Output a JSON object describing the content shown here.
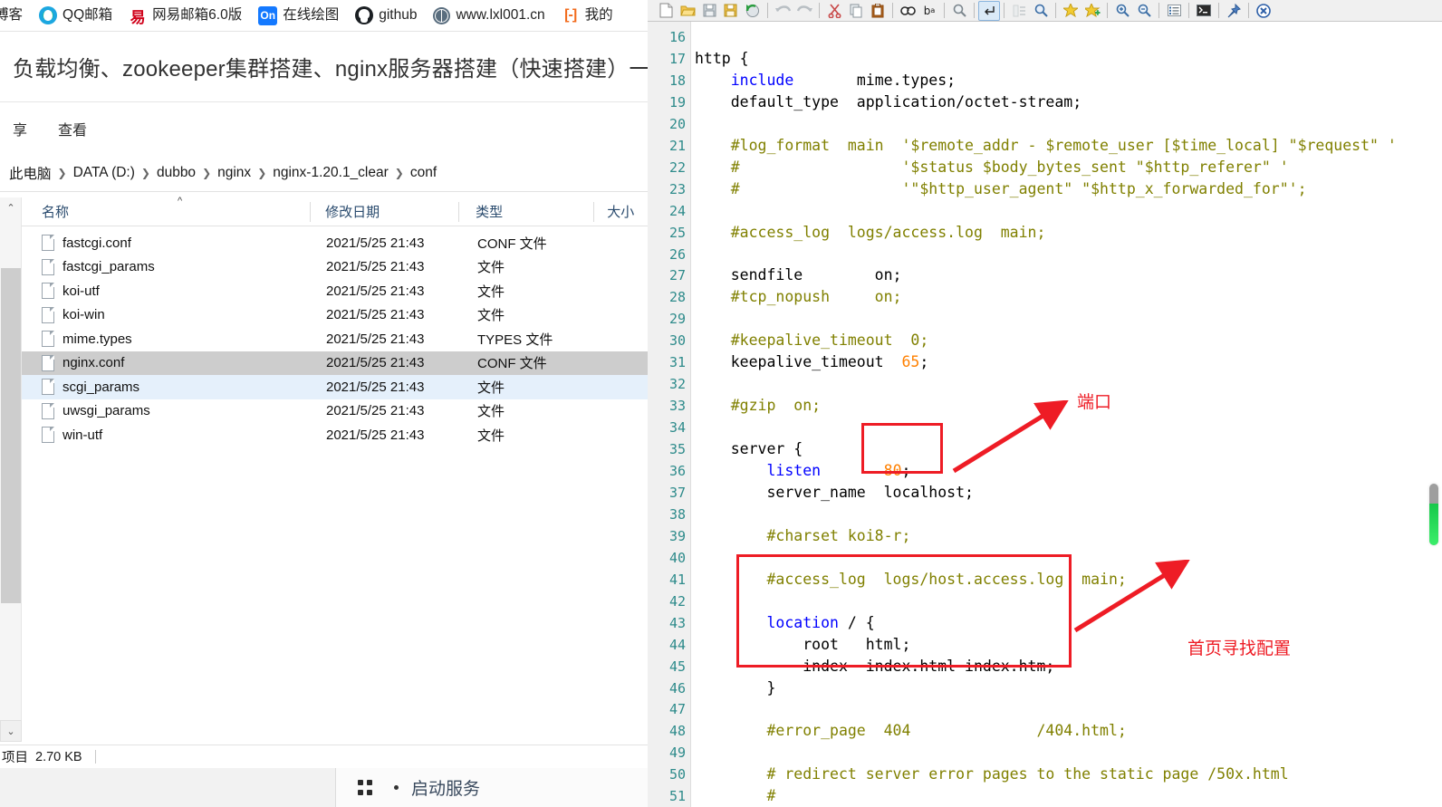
{
  "browser": {
    "bookmarks": [
      {
        "label": "博客",
        "icon": "blog-icon"
      },
      {
        "label": "QQ邮箱",
        "icon": "qq-mail-icon"
      },
      {
        "label": "网易邮箱6.0版",
        "icon": "netease-mail-icon"
      },
      {
        "label": "在线绘图",
        "icon": "online-draw-icon"
      },
      {
        "label": "github",
        "icon": "github-icon"
      },
      {
        "label": "www.lxl001.cn",
        "icon": "globe-icon"
      },
      {
        "label": "我的",
        "icon": "bracket-icon"
      }
    ],
    "page_title": "负载均衡、zookeeper集群搭建、nginx服务器搭建（快速搭建）一文就够"
  },
  "explorer": {
    "ribbon_tabs": [
      {
        "label": "享"
      },
      {
        "label": "查看"
      }
    ],
    "breadcrumb": [
      "此电脑",
      "DATA (D:)",
      "dubbo",
      "nginx",
      "nginx-1.20.1_clear",
      "conf"
    ],
    "columns": {
      "name": "名称",
      "date": "修改日期",
      "type": "类型",
      "size": "大小"
    },
    "sort_caret": "^",
    "files": [
      {
        "name": "fastcgi.conf",
        "date": "2021/5/25 21:43",
        "type": "CONF 文件",
        "state": "normal"
      },
      {
        "name": "fastcgi_params",
        "date": "2021/5/25 21:43",
        "type": "文件",
        "state": "normal"
      },
      {
        "name": "koi-utf",
        "date": "2021/5/25 21:43",
        "type": "文件",
        "state": "normal"
      },
      {
        "name": "koi-win",
        "date": "2021/5/25 21:43",
        "type": "文件",
        "state": "normal"
      },
      {
        "name": "mime.types",
        "date": "2021/5/25 21:43",
        "type": "TYPES 文件",
        "state": "normal"
      },
      {
        "name": "nginx.conf",
        "date": "2021/5/25 21:43",
        "type": "CONF 文件",
        "state": "selected-strong"
      },
      {
        "name": "scgi_params",
        "date": "2021/5/25 21:43",
        "type": "文件",
        "state": "selected-light"
      },
      {
        "name": "uwsgi_params",
        "date": "2021/5/25 21:43",
        "type": "文件",
        "state": "normal"
      },
      {
        "name": "win-utf",
        "date": "2021/5/25 21:43",
        "type": "文件",
        "state": "normal"
      }
    ],
    "status_items_label": "项目",
    "status_size": "2.70 KB"
  },
  "taskbar": {
    "sort_icon": "sort-handles-icon",
    "item_label": "启动服务"
  },
  "notepad": {
    "toolbar_buttons": [
      {
        "name": "new-file-icon",
        "glyph": "🗋"
      },
      {
        "name": "open-folder-icon",
        "glyph": "📂"
      },
      {
        "name": "save-icon",
        "glyph": "💾"
      },
      {
        "name": "save-all-icon",
        "glyph": "🖫"
      },
      {
        "name": "reload-icon",
        "glyph": "⟳"
      },
      {
        "name": "separator",
        "glyph": "|"
      },
      {
        "name": "undo-icon",
        "glyph": "↩"
      },
      {
        "name": "redo-icon",
        "glyph": "↪"
      },
      {
        "name": "separator",
        "glyph": "|"
      },
      {
        "name": "cut-icon",
        "glyph": "✂"
      },
      {
        "name": "copy-icon",
        "glyph": "⧉"
      },
      {
        "name": "paste-icon",
        "glyph": "📋"
      },
      {
        "name": "separator",
        "glyph": "|"
      },
      {
        "name": "find-icon",
        "glyph": "🔍"
      },
      {
        "name": "replace-icon",
        "glyph": "ᵇₐ"
      },
      {
        "name": "separator",
        "glyph": "|"
      },
      {
        "name": "find-prev-icon",
        "glyph": "🔎"
      },
      {
        "name": "separator",
        "glyph": "|"
      },
      {
        "name": "show-all-chars-icon",
        "glyph": "⏎"
      },
      {
        "name": "separator",
        "glyph": "|"
      },
      {
        "name": "indent-guide-icon",
        "glyph": "▤"
      },
      {
        "name": "zoom-sel-icon",
        "glyph": "🔍"
      },
      {
        "name": "separator",
        "glyph": "|"
      },
      {
        "name": "bookmark-icon",
        "glyph": "★"
      },
      {
        "name": "bookmark-add-icon",
        "glyph": "★"
      },
      {
        "name": "separator",
        "glyph": "|"
      },
      {
        "name": "zoom-in-icon",
        "glyph": "🔍"
      },
      {
        "name": "zoom-out-icon",
        "glyph": "🔍"
      },
      {
        "name": "separator",
        "glyph": "|"
      },
      {
        "name": "doc-list-icon",
        "glyph": "▤"
      },
      {
        "name": "separator",
        "glyph": "|"
      },
      {
        "name": "run-console-icon",
        "glyph": "▣"
      },
      {
        "name": "separator",
        "glyph": "|"
      },
      {
        "name": "pin-icon",
        "glyph": "📌"
      },
      {
        "name": "separator",
        "glyph": "|"
      },
      {
        "name": "close-icon",
        "glyph": "✖"
      }
    ],
    "first_line_number": 16,
    "code_lines": [
      {
        "n": 16,
        "tokens": []
      },
      {
        "n": 17,
        "tokens": [
          {
            "t": "http {",
            "c": "plain"
          }
        ]
      },
      {
        "n": 18,
        "tokens": [
          {
            "t": "    ",
            "c": "plain"
          },
          {
            "t": "include",
            "c": "kw"
          },
          {
            "t": "       mime.types;",
            "c": "plain"
          }
        ]
      },
      {
        "n": 19,
        "tokens": [
          {
            "t": "    default_type  application/octet-stream;",
            "c": "plain"
          }
        ]
      },
      {
        "n": 20,
        "tokens": []
      },
      {
        "n": 21,
        "tokens": [
          {
            "t": "    #log_format  main  '$remote_addr - $remote_user [$time_local] \"$request\" '",
            "c": "com"
          }
        ]
      },
      {
        "n": 22,
        "tokens": [
          {
            "t": "    #                  '$status $body_bytes_sent \"$http_referer\" '",
            "c": "com"
          }
        ]
      },
      {
        "n": 23,
        "tokens": [
          {
            "t": "    #                  '\"$http_user_agent\" \"$http_x_forwarded_for\"';",
            "c": "com"
          }
        ]
      },
      {
        "n": 24,
        "tokens": []
      },
      {
        "n": 25,
        "tokens": [
          {
            "t": "    #access_log  logs/access.log  main;",
            "c": "com"
          }
        ]
      },
      {
        "n": 26,
        "tokens": []
      },
      {
        "n": 27,
        "tokens": [
          {
            "t": "    sendfile        on;",
            "c": "plain"
          }
        ]
      },
      {
        "n": 28,
        "tokens": [
          {
            "t": "    #tcp_nopush     on;",
            "c": "com"
          }
        ]
      },
      {
        "n": 29,
        "tokens": []
      },
      {
        "n": 30,
        "tokens": [
          {
            "t": "    #keepalive_timeout  0;",
            "c": "com"
          }
        ]
      },
      {
        "n": 31,
        "tokens": [
          {
            "t": "    keepalive_timeout  ",
            "c": "plain"
          },
          {
            "t": "65",
            "c": "num"
          },
          {
            "t": ";",
            "c": "plain"
          }
        ]
      },
      {
        "n": 32,
        "tokens": []
      },
      {
        "n": 33,
        "tokens": [
          {
            "t": "    #gzip  on;",
            "c": "com"
          }
        ]
      },
      {
        "n": 34,
        "tokens": []
      },
      {
        "n": 35,
        "tokens": [
          {
            "t": "    server {",
            "c": "plain"
          }
        ]
      },
      {
        "n": 36,
        "tokens": [
          {
            "t": "        ",
            "c": "plain"
          },
          {
            "t": "listen",
            "c": "kw"
          },
          {
            "t": "       ",
            "c": "plain"
          },
          {
            "t": "80",
            "c": "num"
          },
          {
            "t": ";",
            "c": "plain"
          }
        ]
      },
      {
        "n": 37,
        "tokens": [
          {
            "t": "        server_name  localhost;",
            "c": "plain"
          }
        ]
      },
      {
        "n": 38,
        "tokens": []
      },
      {
        "n": 39,
        "tokens": [
          {
            "t": "        #charset koi8-r;",
            "c": "com"
          }
        ]
      },
      {
        "n": 40,
        "tokens": []
      },
      {
        "n": 41,
        "tokens": [
          {
            "t": "        #access_log  logs/host.access.log  main;",
            "c": "com"
          }
        ]
      },
      {
        "n": 42,
        "tokens": []
      },
      {
        "n": 43,
        "tokens": [
          {
            "t": "        ",
            "c": "plain"
          },
          {
            "t": "location",
            "c": "kw"
          },
          {
            "t": " / {",
            "c": "plain"
          }
        ]
      },
      {
        "n": 44,
        "tokens": [
          {
            "t": "            root   html;",
            "c": "plain"
          }
        ]
      },
      {
        "n": 45,
        "tokens": [
          {
            "t": "            index  index.html index.htm;",
            "c": "plain"
          }
        ]
      },
      {
        "n": 46,
        "tokens": [
          {
            "t": "        }",
            "c": "plain"
          }
        ]
      },
      {
        "n": 47,
        "tokens": []
      },
      {
        "n": 48,
        "tokens": [
          {
            "t": "        #error_page  404              /404.html;",
            "c": "com"
          }
        ]
      },
      {
        "n": 49,
        "tokens": []
      },
      {
        "n": 50,
        "tokens": [
          {
            "t": "        # redirect server error pages to the static page /50x.html",
            "c": "com"
          }
        ]
      },
      {
        "n": 51,
        "tokens": [
          {
            "t": "        #",
            "c": "com"
          }
        ]
      }
    ],
    "annotations": [
      {
        "name": "port-annotation",
        "label": "端口"
      },
      {
        "name": "homepage-config-annotation",
        "label": "首页寻找配置"
      }
    ]
  },
  "colors": {
    "annotation_red": "#ee1c25",
    "keyword_blue": "#0000ff",
    "comment_olive": "#808000",
    "number_orange": "#ff8000",
    "line_number_teal": "#2e8b8b",
    "selection_strong": "#cdcdcd",
    "selection_light": "#e5f0fb"
  }
}
